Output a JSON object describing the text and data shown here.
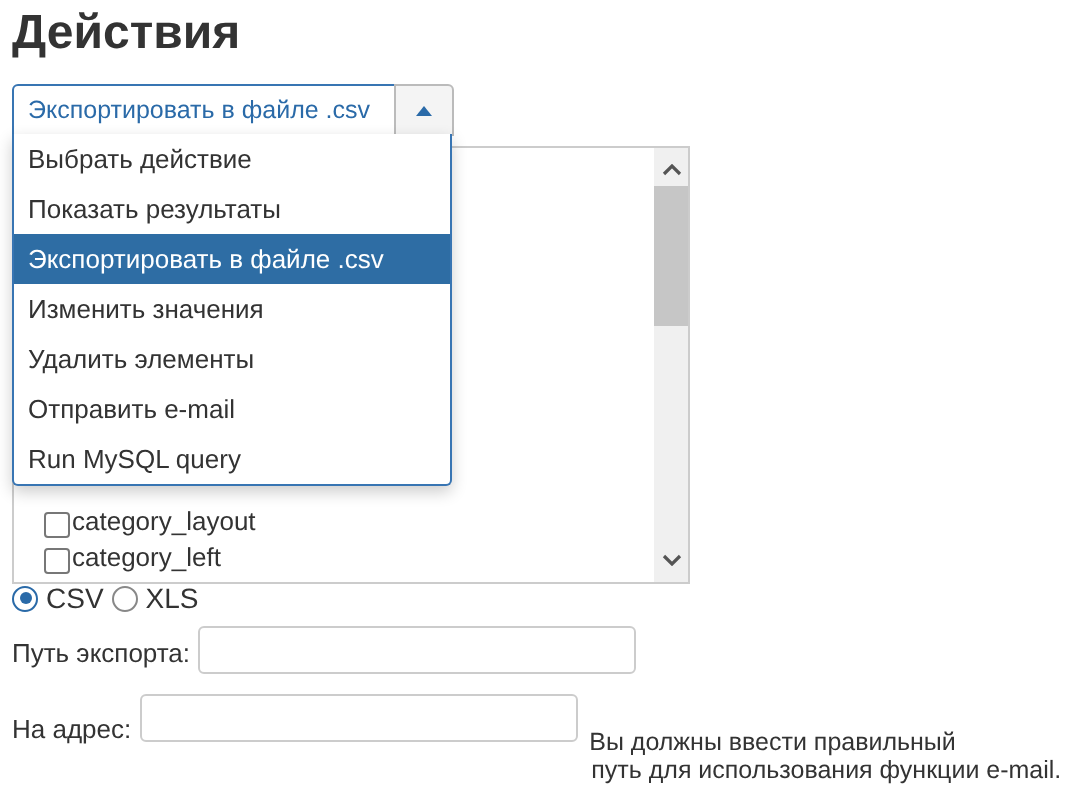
{
  "heading": "Действия",
  "action_select": {
    "value": "Экспортировать в файле .csv",
    "expanded": true,
    "options": [
      {
        "label": "Выбрать действие",
        "selected": false
      },
      {
        "label": "Показать результаты",
        "selected": false
      },
      {
        "label": "Экспортировать в файле .csv",
        "selected": true
      },
      {
        "label": "Изменить значения",
        "selected": false
      },
      {
        "label": "Удалить элементы",
        "selected": false
      },
      {
        "label": "Отправить e-mail",
        "selected": false
      },
      {
        "label": "Run MySQL query",
        "selected": false
      }
    ]
  },
  "fields_list": [
    {
      "label": "category_layout",
      "checked": false
    },
    {
      "label": "category_left",
      "checked": false
    }
  ],
  "format": [
    {
      "label": "CSV",
      "selected": true
    },
    {
      "label": "XLS",
      "selected": false
    }
  ],
  "export_path": {
    "label": "Путь экспорта:"
  },
  "address": {
    "label": "На адрес:",
    "help": [
      "Вы должны ввести правильный",
      "путь для использования функции e-mail."
    ]
  }
}
